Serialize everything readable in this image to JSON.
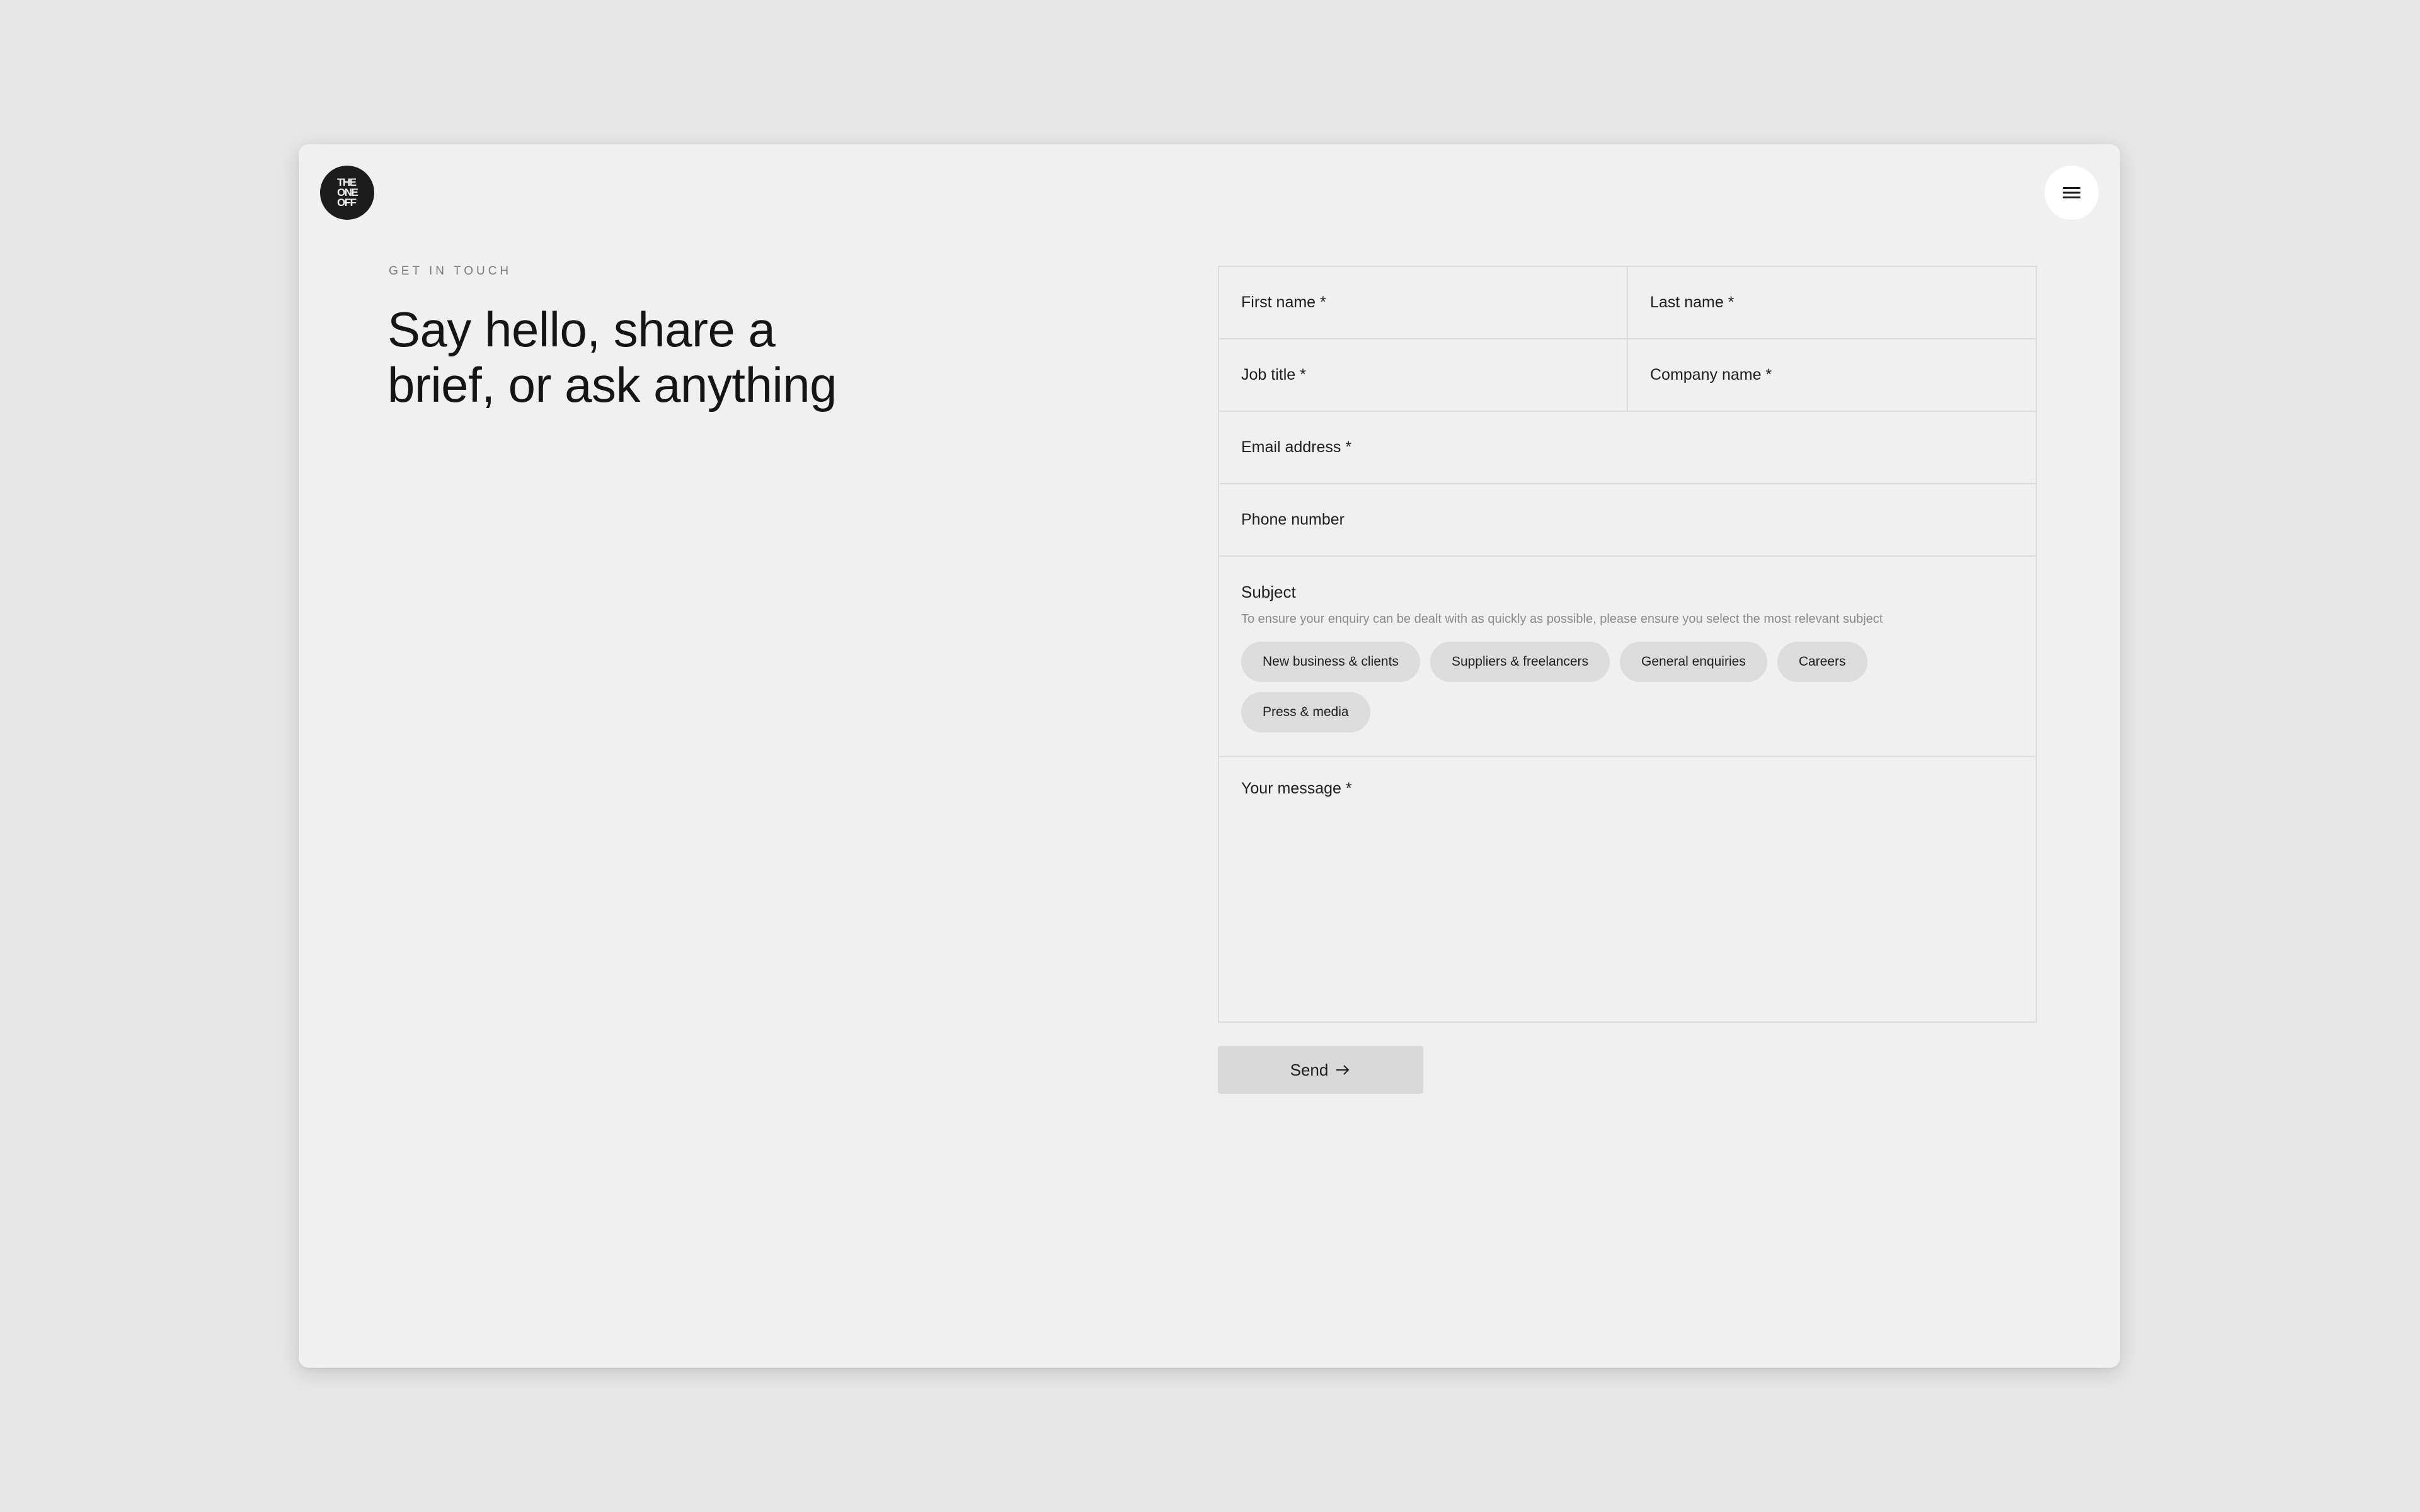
{
  "brand": {
    "logo_text": "THE ONE OFF"
  },
  "header": {
    "menu_icon": "hamburger-menu-icon"
  },
  "intro": {
    "eyebrow": "GET IN TOUCH",
    "headline": "Say hello, share a brief, or ask anything"
  },
  "form": {
    "first_name": "First name *",
    "last_name": "Last name *",
    "job_title": "Job title *",
    "company_name": "Company name *",
    "email": "Email address *",
    "phone": "Phone number",
    "subject": {
      "label": "Subject",
      "hint": "To ensure your enquiry can be dealt with as quickly as possible, please ensure you select the most relevant subject",
      "options": [
        "New business & clients",
        "Suppliers & freelancers",
        "General enquiries",
        "Careers",
        "Press & media"
      ]
    },
    "message": "Your message *",
    "send_label": "Send",
    "send_icon": "arrow-right-icon"
  },
  "colors": {
    "page_bg": "#e7e7e7",
    "panel_bg": "#f0f0f0",
    "chip_bg": "#dcdcdc",
    "logo_bg": "#1c1c1c"
  }
}
